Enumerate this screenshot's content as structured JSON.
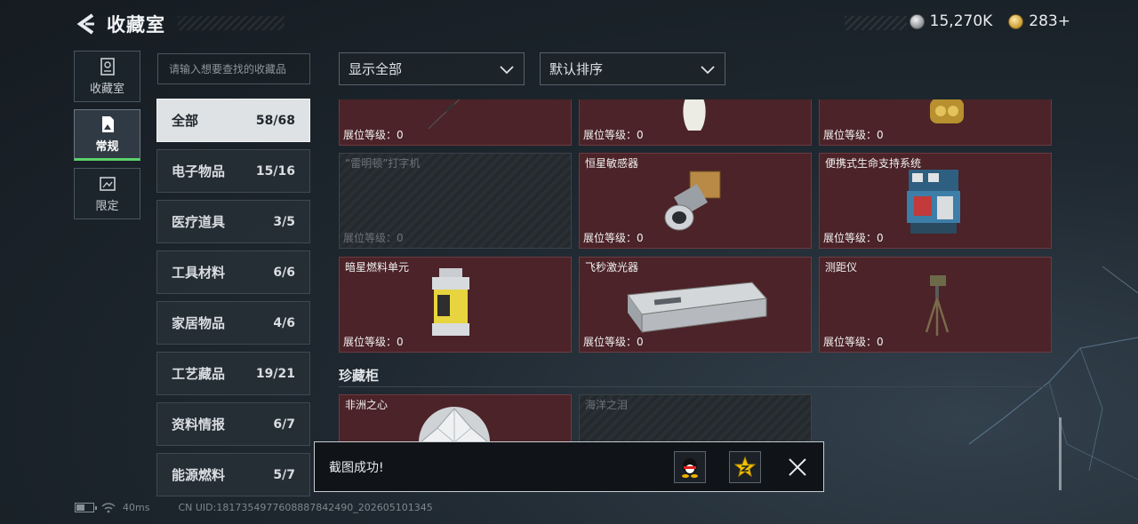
{
  "header": {
    "title": "收藏室",
    "currency_silver": "15,270K",
    "currency_gold": "283+"
  },
  "side_tabs": [
    {
      "label": "收藏室",
      "icon": "collection-icon",
      "active": false
    },
    {
      "label": "常规",
      "icon": "regular-icon",
      "active": true
    },
    {
      "label": "限定",
      "icon": "limited-icon",
      "active": false
    }
  ],
  "search": {
    "placeholder": "请输入想要查找的收藏品"
  },
  "categories": [
    {
      "name": "全部",
      "count": "58/68",
      "active": true
    },
    {
      "name": "电子物品",
      "count": "15/16"
    },
    {
      "name": "医疗道具",
      "count": "3/5"
    },
    {
      "name": "工具材料",
      "count": "6/6"
    },
    {
      "name": "家居物品",
      "count": "4/6"
    },
    {
      "name": "工艺藏品",
      "count": "19/21"
    },
    {
      "name": "资料情报",
      "count": "6/7"
    },
    {
      "name": "能源燃料",
      "count": "5/7"
    }
  ],
  "filters": {
    "display": "显示全部",
    "sort": "默认排序"
  },
  "level_label": "展位等级：",
  "cards_top": [
    {
      "name": "",
      "level": "0",
      "icon": "quill-pen-icon"
    },
    {
      "name": "",
      "level": "0",
      "icon": "vase-icon"
    },
    {
      "name": "",
      "level": "0",
      "icon": "golden-statue-icon"
    }
  ],
  "cards_mid": [
    {
      "name": "“雷明顿”打字机",
      "level": "0",
      "locked": true,
      "icon": ""
    },
    {
      "name": "恒星敏感器",
      "level": "0",
      "icon": "star-sensor-icon"
    },
    {
      "name": "便携式生命支持系统",
      "level": "0",
      "icon": "life-support-icon"
    }
  ],
  "cards_row3": [
    {
      "name": "暗星燃料单元",
      "level": "0",
      "icon": "fuel-canister-icon"
    },
    {
      "name": "飞秒激光器",
      "level": "0",
      "icon": "laser-device-icon"
    },
    {
      "name": "测距仪",
      "level": "0",
      "icon": "rangefinder-icon"
    }
  ],
  "section2": {
    "title": "珍藏柜",
    "cards": [
      {
        "name": "非洲之心",
        "icon": "diamond-icon"
      },
      {
        "name": "海洋之泪",
        "locked": true,
        "icon": ""
      }
    ]
  },
  "toast": {
    "message": "截图成功!"
  },
  "status_bar": {
    "ping": "40ms",
    "uid": "CN UID:1817354977608887842490_202605101345"
  },
  "colors": {
    "card_red": "#4b2328",
    "active_tab_accent": "#5bd36b"
  }
}
